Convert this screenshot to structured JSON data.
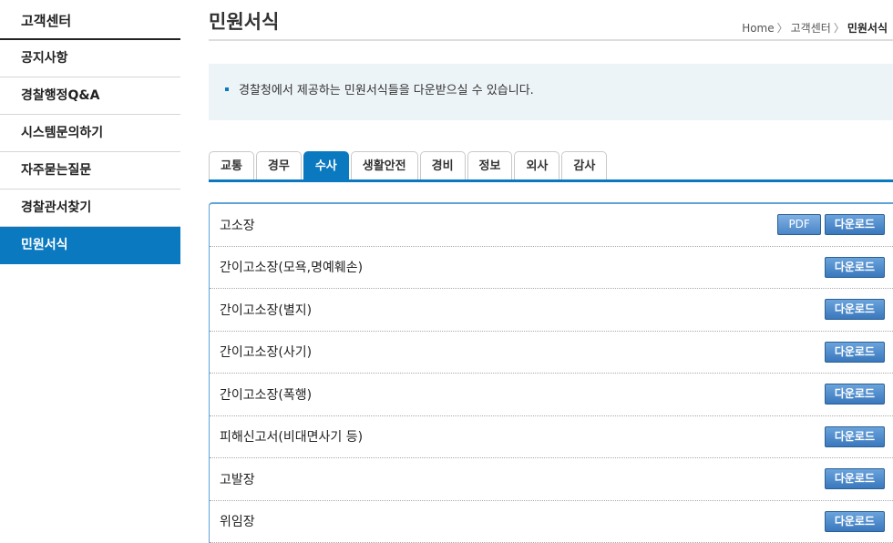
{
  "sidebar": {
    "title": "고객센터",
    "items": [
      {
        "label": "공지사항",
        "active": false
      },
      {
        "label": "경찰행정Q&A",
        "active": false
      },
      {
        "label": "시스템문의하기",
        "active": false
      },
      {
        "label": "자주묻는질문",
        "active": false
      },
      {
        "label": "경찰관서찾기",
        "active": false
      },
      {
        "label": "민원서식",
        "active": true
      }
    ]
  },
  "header": {
    "title": "민원서식",
    "breadcrumb": [
      "Home",
      "고객센터",
      "민원서식"
    ]
  },
  "info": {
    "text": "경찰청에서 제공하는 민원서식들을 다운받으실 수 있습니다."
  },
  "tabs": [
    {
      "label": "교통",
      "active": false
    },
    {
      "label": "경무",
      "active": false
    },
    {
      "label": "수사",
      "active": true
    },
    {
      "label": "생활안전",
      "active": false
    },
    {
      "label": "경비",
      "active": false
    },
    {
      "label": "정보",
      "active": false
    },
    {
      "label": "외사",
      "active": false
    },
    {
      "label": "감사",
      "active": false
    }
  ],
  "buttons": {
    "pdf": "PDF",
    "download": "다운로드"
  },
  "forms": [
    {
      "title": "고소장",
      "pdf": true
    },
    {
      "title": "간이고소장(모욕,명예훼손)",
      "pdf": false
    },
    {
      "title": "간이고소장(별지)",
      "pdf": false
    },
    {
      "title": "간이고소장(사기)",
      "pdf": false
    },
    {
      "title": "간이고소장(폭행)",
      "pdf": false
    },
    {
      "title": "피해신고서(비대면사기 등)",
      "pdf": false
    },
    {
      "title": "고발장",
      "pdf": false
    },
    {
      "title": "위임장",
      "pdf": false
    }
  ],
  "colors": {
    "accent": "#0b79c0",
    "button": "#3a78bd",
    "info_bg": "#edf4f7"
  }
}
